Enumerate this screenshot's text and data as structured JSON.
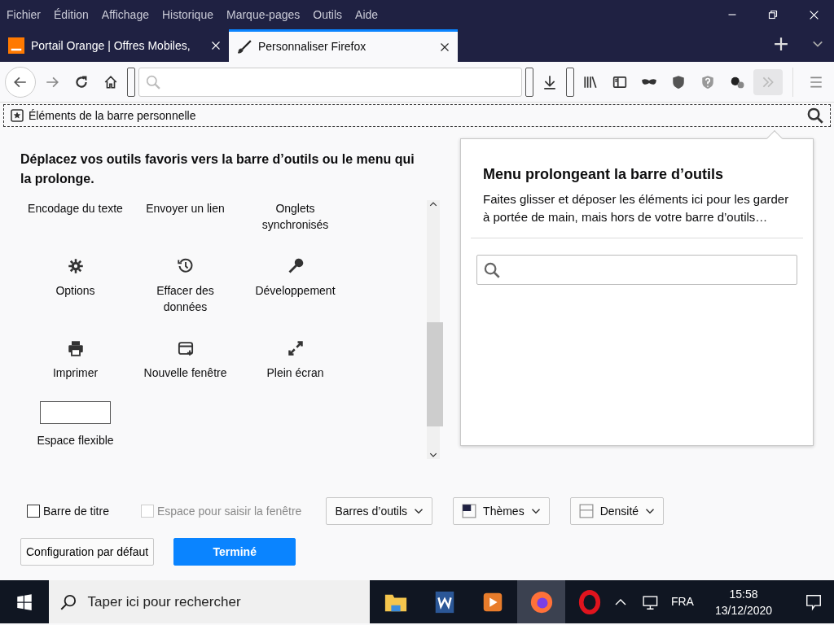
{
  "menu": [
    "Fichier",
    "Édition",
    "Affichage",
    "Historique",
    "Marque-pages",
    "Outils",
    "Aide"
  ],
  "tabs": [
    {
      "kind": "site",
      "label": "Portail Orange | Offres Mobiles,",
      "selected": false
    },
    {
      "kind": "customize",
      "label": "Personnaliser Firefox",
      "selected": true
    }
  ],
  "bookmarks_bar": {
    "label": "Éléments de la barre personnelle"
  },
  "palette": {
    "heading": "Déplacez vos outils favoris vers la barre d’outils ou le menu qui la prolonge.",
    "items": [
      {
        "kind": "text",
        "label": "Encodage du texte"
      },
      {
        "kind": "text",
        "label": "Envoyer un lien"
      },
      {
        "kind": "text",
        "label": "Onglets synchronisés"
      },
      {
        "kind": "gear",
        "label": "Options"
      },
      {
        "kind": "history",
        "label": "Effacer des données"
      },
      {
        "kind": "wrench",
        "label": "Développement"
      },
      {
        "kind": "printer",
        "label": "Imprimer"
      },
      {
        "kind": "window",
        "label": "Nouvelle fenêtre"
      },
      {
        "kind": "expand",
        "label": "Plein écran"
      },
      {
        "kind": "spacer",
        "label": "Espace flexible"
      }
    ]
  },
  "overflow_panel": {
    "title": "Menu prolongeant la barre d’outils",
    "description": "Faites glisser et déposer les éléments ici pour les garder à portée de main, mais hors de votre barre d’outils…"
  },
  "options": [
    {
      "label": "Barre de titre",
      "checked": false,
      "disabled": false
    },
    {
      "label": "Espace pour saisir la fenêtre",
      "checked": false,
      "disabled": true
    }
  ],
  "dropdowns": [
    {
      "kind": "plain",
      "label": "Barres d’outils"
    },
    {
      "kind": "themes",
      "label": "Thèmes"
    },
    {
      "kind": "density",
      "label": "Densité"
    }
  ],
  "buttons": [
    {
      "label": "Configuration par défaut",
      "primary": false
    },
    {
      "label": "Terminé",
      "primary": true
    }
  ],
  "taskbar": {
    "search_placeholder": "Taper ici pour rechercher",
    "language": "FRA",
    "time": "15:58",
    "date": "13/12/2020"
  }
}
